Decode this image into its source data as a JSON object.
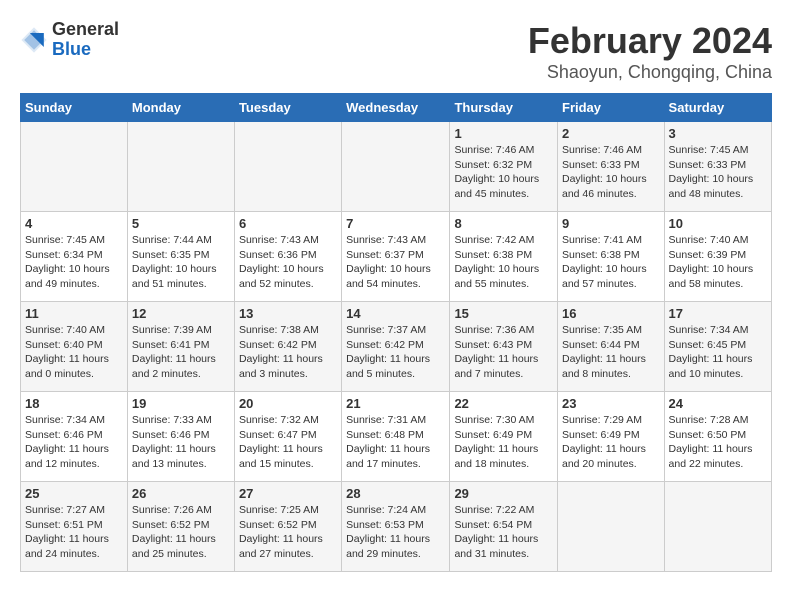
{
  "header": {
    "logo_general": "General",
    "logo_blue": "Blue",
    "main_title": "February 2024",
    "subtitle": "Shaoyun, Chongqing, China"
  },
  "weekdays": [
    "Sunday",
    "Monday",
    "Tuesday",
    "Wednesday",
    "Thursday",
    "Friday",
    "Saturday"
  ],
  "weeks": [
    [
      {
        "day": "",
        "info": ""
      },
      {
        "day": "",
        "info": ""
      },
      {
        "day": "",
        "info": ""
      },
      {
        "day": "",
        "info": ""
      },
      {
        "day": "1",
        "info": "Sunrise: 7:46 AM\nSunset: 6:32 PM\nDaylight: 10 hours\nand 45 minutes."
      },
      {
        "day": "2",
        "info": "Sunrise: 7:46 AM\nSunset: 6:33 PM\nDaylight: 10 hours\nand 46 minutes."
      },
      {
        "day": "3",
        "info": "Sunrise: 7:45 AM\nSunset: 6:33 PM\nDaylight: 10 hours\nand 48 minutes."
      }
    ],
    [
      {
        "day": "4",
        "info": "Sunrise: 7:45 AM\nSunset: 6:34 PM\nDaylight: 10 hours\nand 49 minutes."
      },
      {
        "day": "5",
        "info": "Sunrise: 7:44 AM\nSunset: 6:35 PM\nDaylight: 10 hours\nand 51 minutes."
      },
      {
        "day": "6",
        "info": "Sunrise: 7:43 AM\nSunset: 6:36 PM\nDaylight: 10 hours\nand 52 minutes."
      },
      {
        "day": "7",
        "info": "Sunrise: 7:43 AM\nSunset: 6:37 PM\nDaylight: 10 hours\nand 54 minutes."
      },
      {
        "day": "8",
        "info": "Sunrise: 7:42 AM\nSunset: 6:38 PM\nDaylight: 10 hours\nand 55 minutes."
      },
      {
        "day": "9",
        "info": "Sunrise: 7:41 AM\nSunset: 6:38 PM\nDaylight: 10 hours\nand 57 minutes."
      },
      {
        "day": "10",
        "info": "Sunrise: 7:40 AM\nSunset: 6:39 PM\nDaylight: 10 hours\nand 58 minutes."
      }
    ],
    [
      {
        "day": "11",
        "info": "Sunrise: 7:40 AM\nSunset: 6:40 PM\nDaylight: 11 hours\nand 0 minutes."
      },
      {
        "day": "12",
        "info": "Sunrise: 7:39 AM\nSunset: 6:41 PM\nDaylight: 11 hours\nand 2 minutes."
      },
      {
        "day": "13",
        "info": "Sunrise: 7:38 AM\nSunset: 6:42 PM\nDaylight: 11 hours\nand 3 minutes."
      },
      {
        "day": "14",
        "info": "Sunrise: 7:37 AM\nSunset: 6:42 PM\nDaylight: 11 hours\nand 5 minutes."
      },
      {
        "day": "15",
        "info": "Sunrise: 7:36 AM\nSunset: 6:43 PM\nDaylight: 11 hours\nand 7 minutes."
      },
      {
        "day": "16",
        "info": "Sunrise: 7:35 AM\nSunset: 6:44 PM\nDaylight: 11 hours\nand 8 minutes."
      },
      {
        "day": "17",
        "info": "Sunrise: 7:34 AM\nSunset: 6:45 PM\nDaylight: 11 hours\nand 10 minutes."
      }
    ],
    [
      {
        "day": "18",
        "info": "Sunrise: 7:34 AM\nSunset: 6:46 PM\nDaylight: 11 hours\nand 12 minutes."
      },
      {
        "day": "19",
        "info": "Sunrise: 7:33 AM\nSunset: 6:46 PM\nDaylight: 11 hours\nand 13 minutes."
      },
      {
        "day": "20",
        "info": "Sunrise: 7:32 AM\nSunset: 6:47 PM\nDaylight: 11 hours\nand 15 minutes."
      },
      {
        "day": "21",
        "info": "Sunrise: 7:31 AM\nSunset: 6:48 PM\nDaylight: 11 hours\nand 17 minutes."
      },
      {
        "day": "22",
        "info": "Sunrise: 7:30 AM\nSunset: 6:49 PM\nDaylight: 11 hours\nand 18 minutes."
      },
      {
        "day": "23",
        "info": "Sunrise: 7:29 AM\nSunset: 6:49 PM\nDaylight: 11 hours\nand 20 minutes."
      },
      {
        "day": "24",
        "info": "Sunrise: 7:28 AM\nSunset: 6:50 PM\nDaylight: 11 hours\nand 22 minutes."
      }
    ],
    [
      {
        "day": "25",
        "info": "Sunrise: 7:27 AM\nSunset: 6:51 PM\nDaylight: 11 hours\nand 24 minutes."
      },
      {
        "day": "26",
        "info": "Sunrise: 7:26 AM\nSunset: 6:52 PM\nDaylight: 11 hours\nand 25 minutes."
      },
      {
        "day": "27",
        "info": "Sunrise: 7:25 AM\nSunset: 6:52 PM\nDaylight: 11 hours\nand 27 minutes."
      },
      {
        "day": "28",
        "info": "Sunrise: 7:24 AM\nSunset: 6:53 PM\nDaylight: 11 hours\nand 29 minutes."
      },
      {
        "day": "29",
        "info": "Sunrise: 7:22 AM\nSunset: 6:54 PM\nDaylight: 11 hours\nand 31 minutes."
      },
      {
        "day": "",
        "info": ""
      },
      {
        "day": "",
        "info": ""
      }
    ]
  ]
}
